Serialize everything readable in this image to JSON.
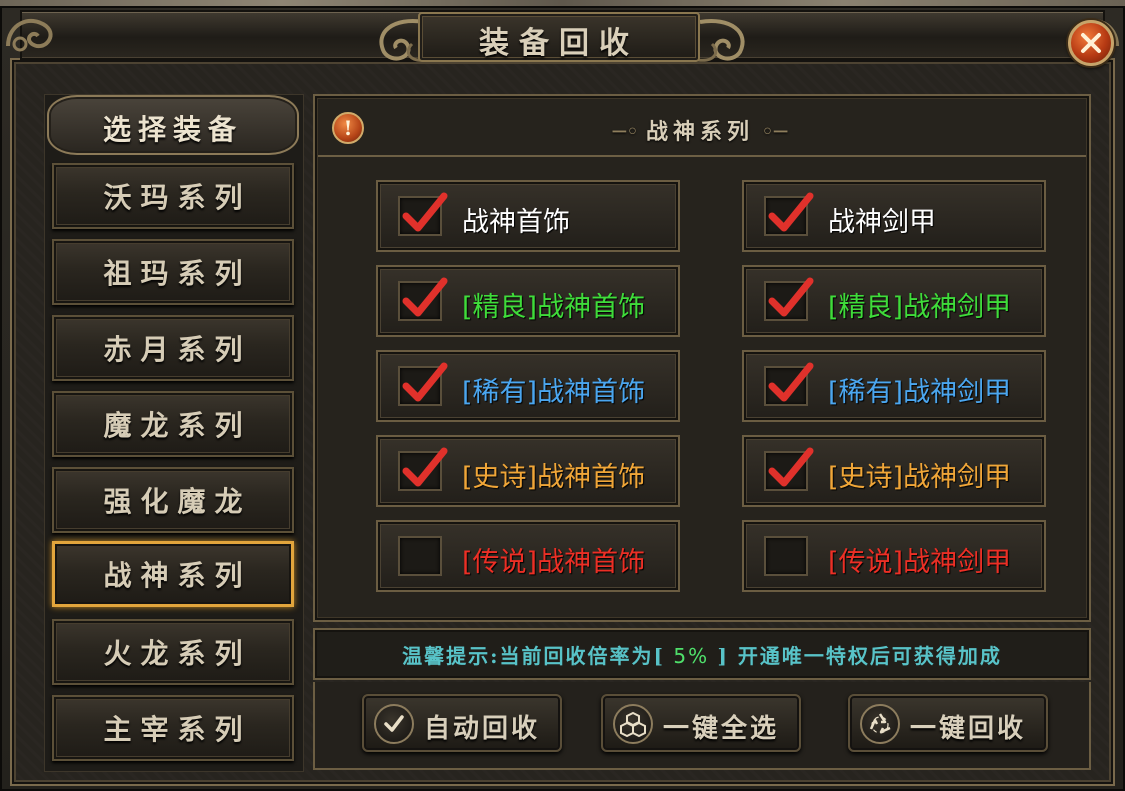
{
  "window": {
    "title": "装备回收"
  },
  "sidebar": {
    "header": "选择装备",
    "items": [
      {
        "label": "沃玛系列",
        "selected": false
      },
      {
        "label": "祖玛系列",
        "selected": false
      },
      {
        "label": "赤月系列",
        "selected": false
      },
      {
        "label": "魔龙系列",
        "selected": false
      },
      {
        "label": "强化魔龙",
        "selected": false
      },
      {
        "label": "战神系列",
        "selected": true
      },
      {
        "label": "火龙系列",
        "selected": false
      },
      {
        "label": "主宰系列",
        "selected": false
      }
    ]
  },
  "panel": {
    "title": "战神系列",
    "items": [
      {
        "label": "战神首饰",
        "checked": true,
        "color": "#ffffff"
      },
      {
        "label": "战神剑甲",
        "checked": true,
        "color": "#ffffff"
      },
      {
        "label": "[精良]战神首饰",
        "checked": true,
        "color": "#3fdc3a"
      },
      {
        "label": "[精良]战神剑甲",
        "checked": true,
        "color": "#3fdc3a"
      },
      {
        "label": "[稀有]战神首饰",
        "checked": true,
        "color": "#4ba6ef"
      },
      {
        "label": "[稀有]战神剑甲",
        "checked": true,
        "color": "#4ba6ef"
      },
      {
        "label": "[史诗]战神首饰",
        "checked": true,
        "color": "#f0a638"
      },
      {
        "label": "[史诗]战神剑甲",
        "checked": true,
        "color": "#f0a638"
      },
      {
        "label": "[传说]战神首饰",
        "checked": false,
        "color": "#ec2f25"
      },
      {
        "label": "[传说]战神剑甲",
        "checked": false,
        "color": "#ec2f25"
      }
    ]
  },
  "tip": {
    "prefix": "温馨提示:当前回收倍率为[",
    "rate": " 5% ",
    "suffix": "] 开通唯一特权后可获得加成"
  },
  "actions": {
    "auto": "自动回收",
    "select_all": "一键全选",
    "recycle": "一键回收"
  },
  "colors": {
    "accent_gold": "#e2a53c",
    "tip_cyan": "#58c3c8",
    "rate_green": "#4fe06b",
    "check_red": "#e0312b"
  },
  "icons": {
    "close": "close-icon",
    "info": "info-icon",
    "auto": "checkmark-icon",
    "select_all": "cubes-icon",
    "recycle": "recycle-icon"
  }
}
